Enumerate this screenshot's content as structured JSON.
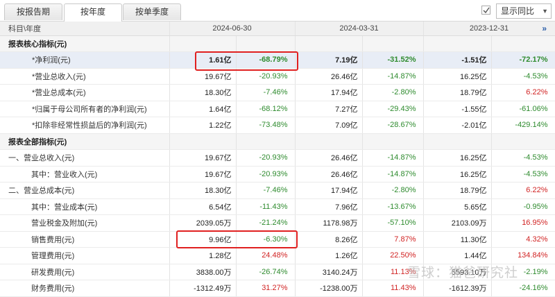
{
  "tabs": [
    {
      "label": "按报告期"
    },
    {
      "label": "按年度"
    },
    {
      "label": "按单季度"
    }
  ],
  "compare": {
    "checked": true,
    "selected": "显示同比"
  },
  "header": {
    "label": "科目\\年度",
    "dates": [
      "2024-06-30",
      "2024-03-31",
      "2023-12-31"
    ]
  },
  "rows": [
    {
      "name": "报表核心指标(元)",
      "section": true,
      "cells": []
    },
    {
      "name": "*净利润(元)",
      "indent": true,
      "bold": true,
      "cells": [
        "1.61亿",
        "-68.79%",
        "7.19亿",
        "-31.52%",
        "-1.51亿",
        "-72.17%"
      ],
      "dir": [
        "dn",
        "dn",
        "dn"
      ]
    },
    {
      "name": "*营业总收入(元)",
      "indent": true,
      "cells": [
        "19.67亿",
        "-20.93%",
        "26.46亿",
        "-14.87%",
        "16.25亿",
        "-4.53%"
      ],
      "dir": [
        "dn",
        "dn",
        "dn"
      ]
    },
    {
      "name": "*营业总成本(元)",
      "indent": true,
      "cells": [
        "18.30亿",
        "-7.46%",
        "17.94亿",
        "-2.80%",
        "18.79亿",
        "6.22%"
      ],
      "dir": [
        "dn",
        "dn",
        "up"
      ]
    },
    {
      "name": "*归属于母公司所有者的净利润(元)",
      "indent": true,
      "cells": [
        "1.64亿",
        "-68.12%",
        "7.27亿",
        "-29.43%",
        "-1.55亿",
        "-61.06%"
      ],
      "dir": [
        "dn",
        "dn",
        "dn"
      ]
    },
    {
      "name": "*扣除非经常性损益后的净利润(元)",
      "indent": true,
      "cells": [
        "1.22亿",
        "-73.48%",
        "7.09亿",
        "-28.67%",
        "-2.01亿",
        "-429.14%"
      ],
      "dir": [
        "dn",
        "dn",
        "dn"
      ]
    },
    {
      "name": "报表全部指标(元)",
      "section": true,
      "cells": []
    },
    {
      "name": "一、营业总收入(元)",
      "cells": [
        "19.67亿",
        "-20.93%",
        "26.46亿",
        "-14.87%",
        "16.25亿",
        "-4.53%"
      ],
      "dir": [
        "dn",
        "dn",
        "dn"
      ]
    },
    {
      "name": "其中：营业收入(元)",
      "indent2": true,
      "cells": [
        "19.67亿",
        "-20.93%",
        "26.46亿",
        "-14.87%",
        "16.25亿",
        "-4.53%"
      ],
      "dir": [
        "dn",
        "dn",
        "dn"
      ]
    },
    {
      "name": "二、营业总成本(元)",
      "cells": [
        "18.30亿",
        "-7.46%",
        "17.94亿",
        "-2.80%",
        "18.79亿",
        "6.22%"
      ],
      "dir": [
        "dn",
        "dn",
        "up"
      ]
    },
    {
      "name": "其中：营业成本(元)",
      "indent2": true,
      "cells": [
        "6.54亿",
        "-11.43%",
        "7.96亿",
        "-13.67%",
        "5.65亿",
        "-0.95%"
      ],
      "dir": [
        "dn",
        "dn",
        "dn"
      ]
    },
    {
      "name": "营业税金及附加(元)",
      "indent2": true,
      "cells": [
        "2039.05万",
        "-21.24%",
        "1178.98万",
        "-57.10%",
        "2103.09万",
        "16.95%"
      ],
      "dir": [
        "dn",
        "dn",
        "up"
      ]
    },
    {
      "name": "销售费用(元)",
      "indent2": true,
      "cells": [
        "9.96亿",
        "-6.30%",
        "8.26亿",
        "7.87%",
        "11.30亿",
        "4.32%"
      ],
      "dir": [
        "dn",
        "up",
        "up"
      ]
    },
    {
      "name": "管理费用(元)",
      "indent2": true,
      "cells": [
        "1.28亿",
        "24.48%",
        "1.26亿",
        "22.50%",
        "1.44亿",
        "134.84%"
      ],
      "dir": [
        "up",
        "up",
        "up"
      ]
    },
    {
      "name": "研发费用(元)",
      "indent2": true,
      "cells": [
        "3838.00万",
        "-26.74%",
        "3140.24万",
        "11.13%",
        "5593.10万",
        "-2.19%"
      ],
      "dir": [
        "dn",
        "up",
        "dn"
      ]
    },
    {
      "name": "财务费用(元)",
      "indent2": true,
      "cells": [
        "-1312.49万",
        "31.27%",
        "-1238.00万",
        "11.43%",
        "-1612.39万",
        "-24.16%"
      ],
      "dir": [
        "up",
        "up",
        "dn"
      ]
    }
  ],
  "watermark": "雪球：猫爸研究社",
  "colors": {
    "down": "#2e8b2e",
    "up": "#d12323",
    "highlight": "#e02020"
  }
}
